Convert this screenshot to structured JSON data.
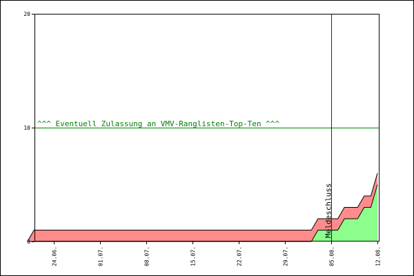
{
  "chart_data": {
    "type": "area",
    "title": "",
    "xlabel": "",
    "ylabel": "",
    "ylim": [
      0,
      20
    ],
    "yticks": [
      "0",
      "10",
      "20"
    ],
    "xticks": [
      "24.06.",
      "01.07.",
      "08.07.",
      "15.07.",
      "22.07.",
      "29.07.",
      "05.08.",
      "12.08."
    ],
    "x": [
      "20.06.",
      "21.06.",
      "02.08.",
      "03.08.",
      "06.08.",
      "07.08.",
      "09.08.",
      "10.08.",
      "11.08.",
      "12.08."
    ],
    "series": [
      {
        "values": [
          0,
          1,
          1,
          2,
          2,
          3,
          3,
          4,
          4,
          6
        ]
      },
      {
        "values": [
          0,
          0,
          0,
          1,
          1,
          2,
          2,
          3,
          3,
          5
        ]
      }
    ],
    "reference_line": {
      "y": 10,
      "label": "^^^ Eventuell Zulassung an VMV-Ranglisten-Top-Ten ^^^",
      "color": "#008000"
    },
    "vertical_marker": {
      "x": "05.08.",
      "label": "Meldeschluss",
      "color": "#800000"
    },
    "colors": {
      "series_1": "#ff8c8c",
      "series_2": "#8cff8c",
      "axis": "#000000",
      "frame": "#000000"
    },
    "grid": false
  }
}
